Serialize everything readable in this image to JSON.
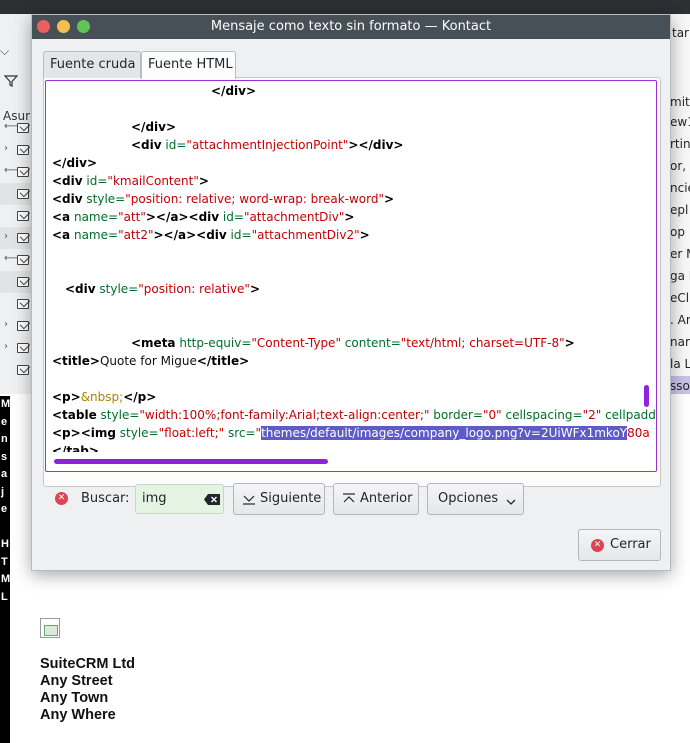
{
  "window": {
    "title": "Mensaje como texto sin formato — Kontact"
  },
  "tabs": [
    {
      "label": "Fuente cruda",
      "active": false
    },
    {
      "label": "Fuente HTML",
      "active": true
    }
  ],
  "code": {
    "line1": {
      "t1": "</div>"
    },
    "line2": {
      "t1": "</div>"
    },
    "line3": {
      "t1": "<div",
      "a1": " id=",
      "v1": "\"attachmentInjectionPoint\"",
      "t2": "></div>"
    },
    "line4": {
      "t1": "</div>"
    },
    "line5": {
      "t1": "<div",
      "a1": " id=",
      "v1": "\"kmailContent\"",
      "t2": ">"
    },
    "line6": {
      "t1": "<div",
      "a1": " style=",
      "v1": "\"position: relative; word-wrap: break-word\"",
      "t2": ">"
    },
    "line7": {
      "t1": "<a",
      "a1": " name=",
      "v1": "\"att\"",
      "t2": "></a><div",
      "a2": " id=",
      "v2": "\"attachmentDiv\"",
      "t3": ">"
    },
    "line8": {
      "t1": "<a",
      "a1": " name=",
      "v1": "\"att2\"",
      "t2": "></a><div",
      "a2": " id=",
      "v2": "\"attachmentDiv2\"",
      "t3": ">"
    },
    "line9": {
      "t1": "<div",
      "a1": " style=",
      "v1": "\"position: relative\"",
      "t2": ">"
    },
    "line10": {
      "t1": "<meta",
      "a1": " http-equiv=",
      "v1": "\"Content-Type\"",
      "a2": " content=",
      "v2": "\"text/html; charset=UTF-8\"",
      "t2": ">"
    },
    "line11": {
      "t1": "<title>",
      "x1": "Quote for Migue",
      "t2": "</title>"
    },
    "line12": {
      "t1": "<p>",
      "e1": "&nbsp;",
      "t2": "</p>"
    },
    "line13": {
      "t1": "<table",
      "a1": " style=",
      "v1": "\"width:100%;font-family:Arial;text-align:center;\"",
      "a2": " border=",
      "v2": "\"0\"",
      "a3": " cellspacing=",
      "v3": "\"2\"",
      "a4": " cellpadding"
    },
    "line14": {
      "t1": "<p><img",
      "a1": " style=",
      "v1": "\"float:left;\"",
      "a2": " src=",
      "v2": "\"",
      "hl": "themes/default/images/company_logo.png?v=2UiWFx1mkoY",
      "v3": "80a"
    },
    "line15": {
      "t1": "</tab>"
    }
  },
  "find": {
    "label": "Buscar:",
    "value": "img",
    "next_label": "Siguiente",
    "prev_label": "Anterior",
    "options_label": "Opciones"
  },
  "close_label": "Cerrar",
  "background": {
    "left_texts": [
      "Asur"
    ],
    "right_texts": [
      "tar",
      "mit",
      "ew1",
      "rtin",
      "or, ",
      "ncie",
      "epl",
      "op ",
      "er M",
      "ga I",
      "eCl",
      ". An",
      "nar",
      "la L",
      "sso"
    ],
    "vertical_text": [
      "M",
      "e",
      "n",
      "s",
      "a",
      "j",
      "e",
      "",
      "H",
      "T",
      "M",
      "L"
    ]
  },
  "preview": {
    "address_lines": [
      "SuiteCRM Ltd",
      "Any Street",
      "Any Town",
      "Any Where"
    ]
  },
  "colors": {
    "accent": "#8e22dd",
    "selection": "#5e5ac8",
    "titlebar": "#475057",
    "tag": "#000000",
    "attribute": "#006e28",
    "value": "#bf0303",
    "entity": "#b08000"
  }
}
